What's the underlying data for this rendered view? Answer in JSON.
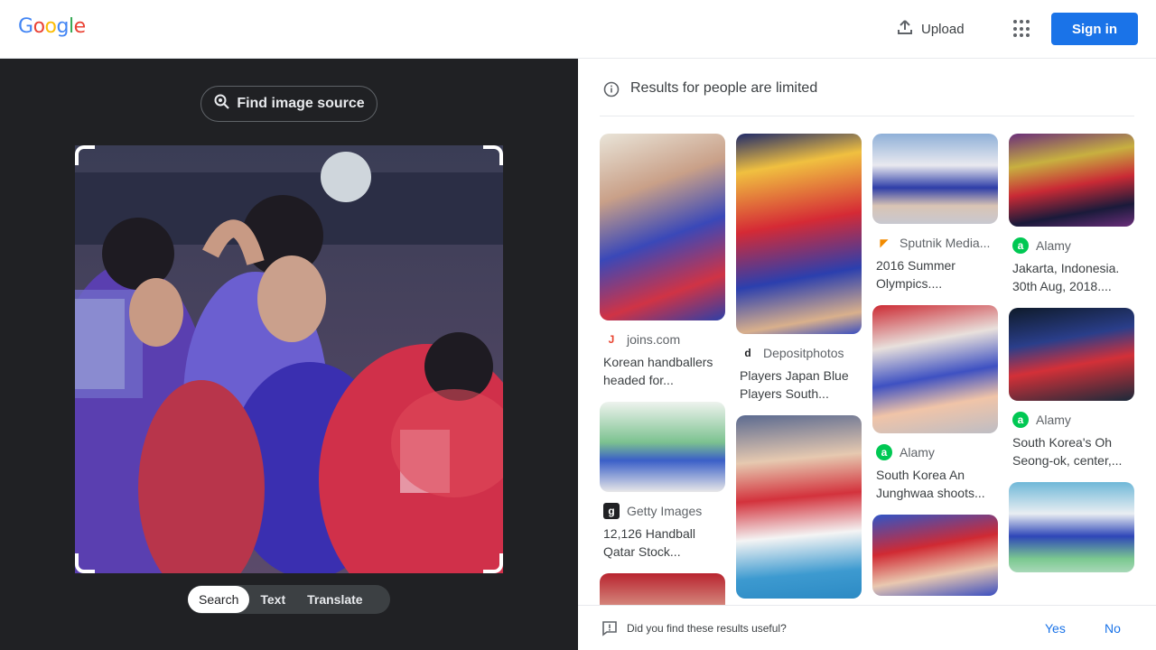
{
  "header": {
    "logo_letters": [
      {
        "ch": "G",
        "color": "#4285f4"
      },
      {
        "ch": "o",
        "color": "#ea4335"
      },
      {
        "ch": "o",
        "color": "#fbbc05"
      },
      {
        "ch": "g",
        "color": "#4285f4"
      },
      {
        "ch": "l",
        "color": "#34a853"
      },
      {
        "ch": "e",
        "color": "#ea4335"
      }
    ],
    "upload_label": "Upload",
    "apps_icon": "apps-grid-icon",
    "signin_label": "Sign in",
    "accent": "#1a73e8"
  },
  "left_panel": {
    "find_source_label": "Find image source",
    "modes": [
      "Search",
      "Text",
      "Translate"
    ],
    "active_mode": "Search"
  },
  "right_panel": {
    "notice": "Results for people are limited",
    "results": [
      {
        "col": 0,
        "source": "joins.com",
        "icon": "J",
        "icon_color": "#e8432f",
        "title": "Korean handballers\nheaded for..."
      },
      {
        "col": 0,
        "source": "Getty Images",
        "icon": "g",
        "icon_color": "#202124",
        "title": "12,126 Handball\nQatar Stock..."
      },
      {
        "col": 1,
        "source": "Depositphotos",
        "icon": "d",
        "icon_color": "#202124",
        "title": "Players Japan Blue\nPlayers South..."
      },
      {
        "col": 2,
        "source": "Sputnik Media...",
        "icon": "◤",
        "icon_color": "#f28b00",
        "title": "2016 Summer\nOlympics...."
      },
      {
        "col": 2,
        "source": "Alamy",
        "icon": "a",
        "icon_color": "#00c853",
        "title": "South Korea An\nJunghwaa shoots..."
      },
      {
        "col": 3,
        "source": "Alamy",
        "icon": "a",
        "icon_color": "#00c853",
        "title": "Jakarta, Indonesia.\n30th Aug, 2018...."
      },
      {
        "col": 3,
        "source": "Alamy",
        "icon": "a",
        "icon_color": "#00c853",
        "title": "South Korea's Oh\nSeong-ok, center,..."
      }
    ],
    "feedback_question": "Did you find these results useful?",
    "feedback_yes": "Yes",
    "feedback_no": "No"
  }
}
